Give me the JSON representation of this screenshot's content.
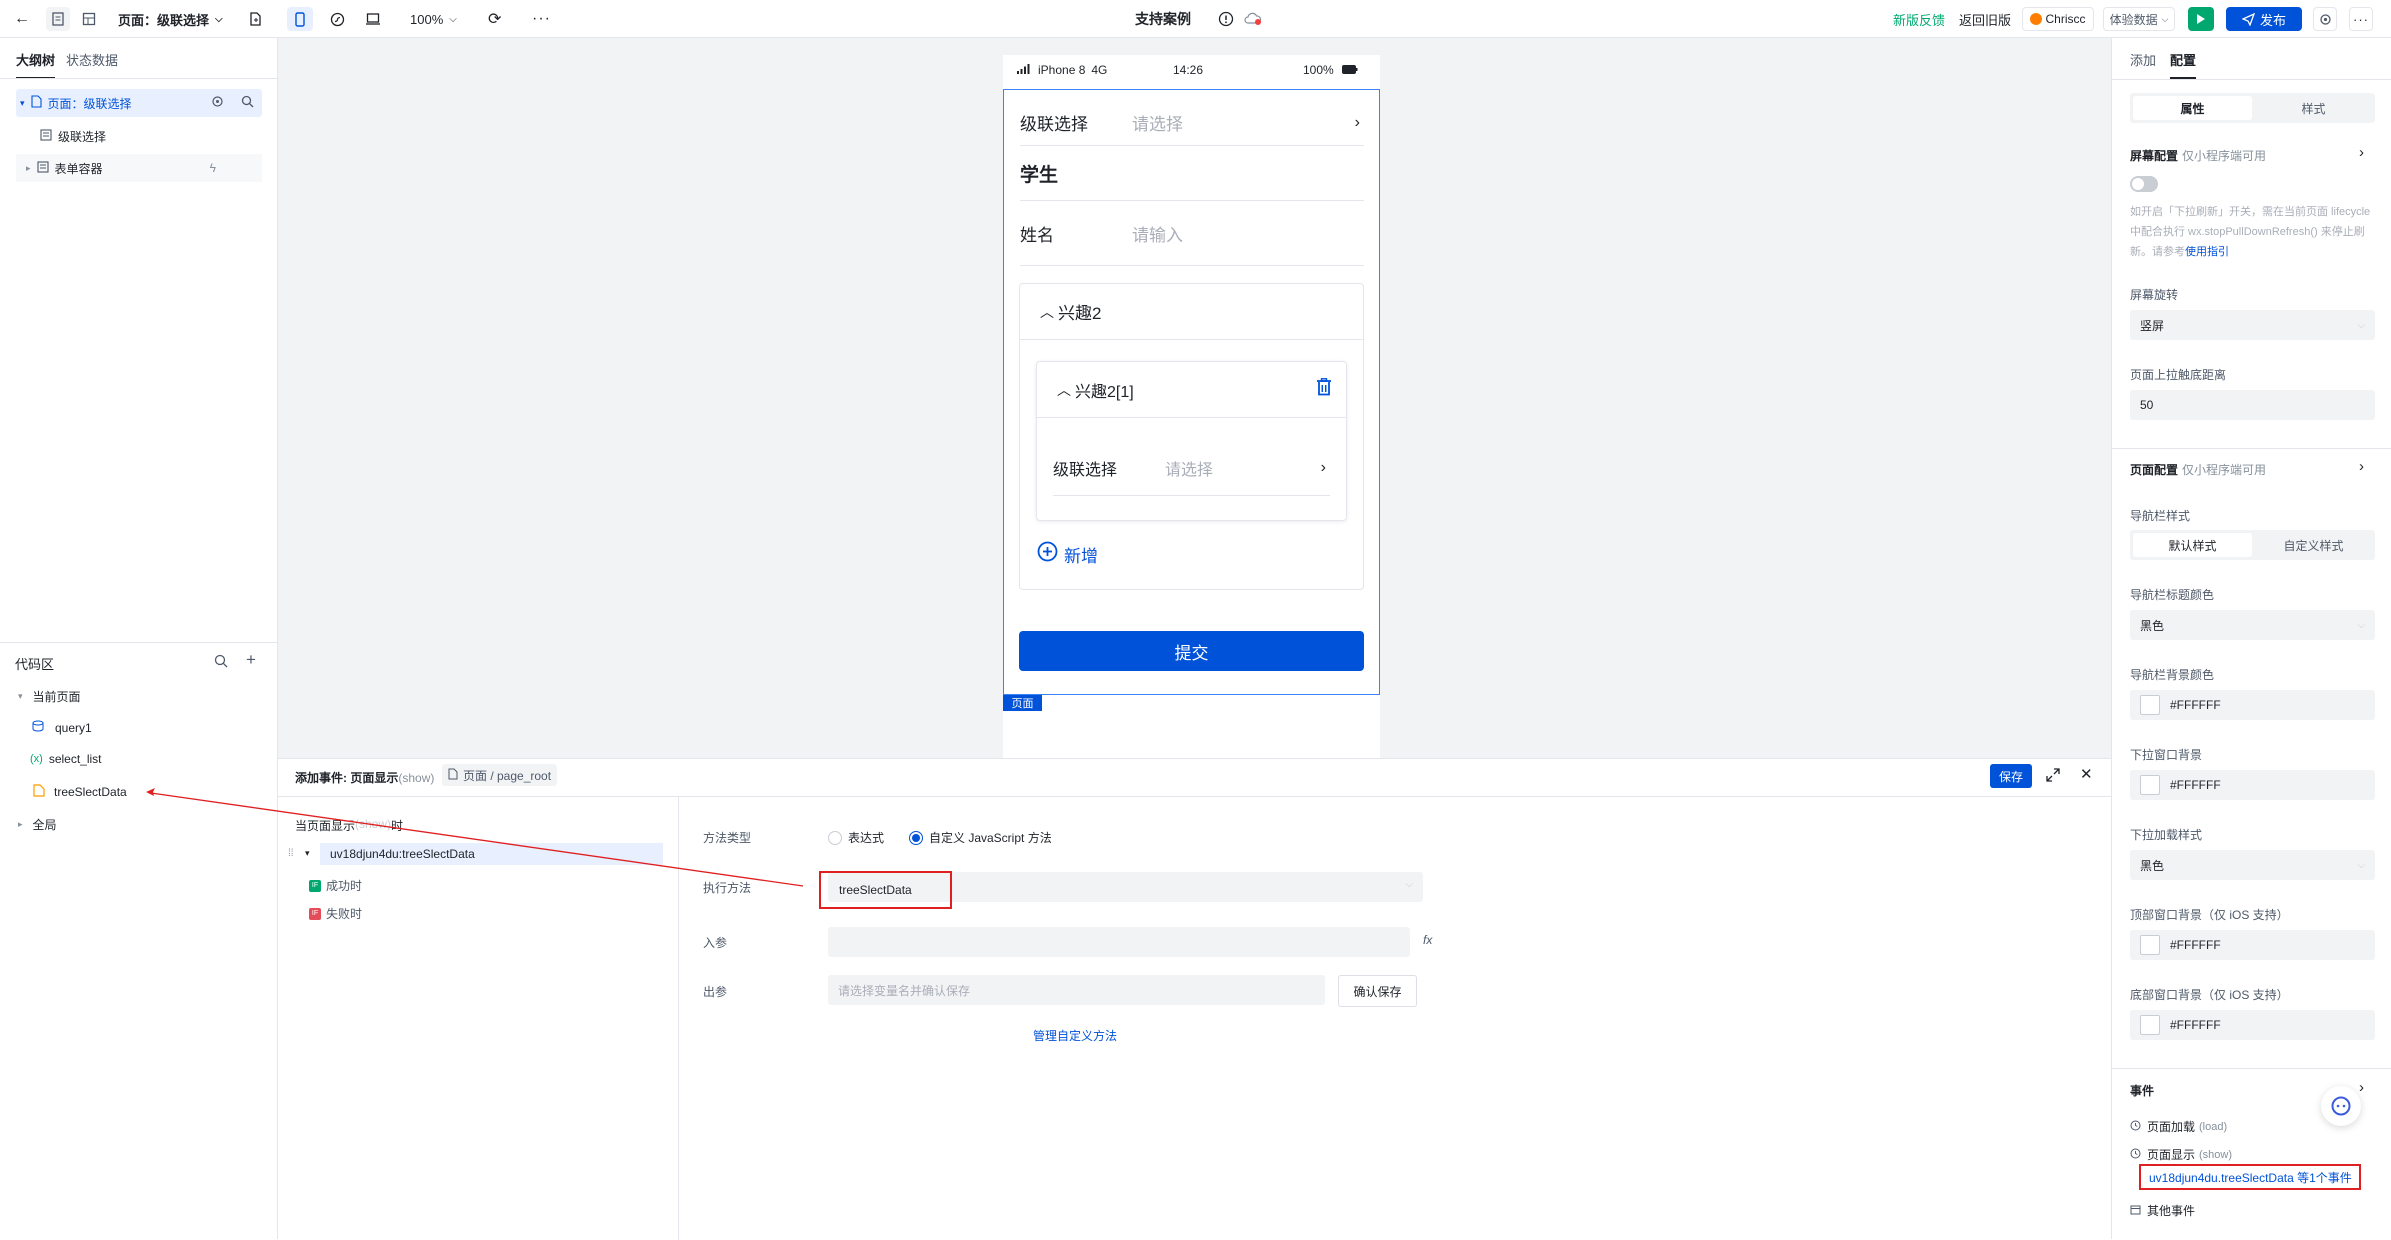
{
  "topbar": {
    "page_selector": "页面：级联选择",
    "zoom": "100%",
    "title": "支持案例",
    "feedback": "新版反馈",
    "back_old": "返回旧版",
    "user": "Chriscc",
    "experience_data": "体验数据",
    "publish": "发布"
  },
  "left": {
    "tabs": [
      "大纲树",
      "状态数据"
    ],
    "tree": {
      "root": "页面：级联选择",
      "child1": "级联选择",
      "child2": "表单容器"
    },
    "code_title": "代码区",
    "current_page": "当前页面",
    "items": [
      "query1",
      "select_list",
      "treeSlectData"
    ],
    "var_prefix": "(x)",
    "global": "全局"
  },
  "phone": {
    "carrier": "iPhone 8",
    "network": "4G",
    "time": "14:26",
    "battery": "100%",
    "row1_label": "级联选择",
    "row1_placeholder": "请选择",
    "section": "学生",
    "name_label": "姓名",
    "name_placeholder": "请输入",
    "group_title": "兴趣2",
    "item_title": "兴趣2[1]",
    "inner_label": "级联选择",
    "inner_placeholder": "请选择",
    "add": "新增",
    "submit": "提交",
    "page_badge": "页面"
  },
  "bottom": {
    "title": "添加事件: 页面显示",
    "title_hint": "(show)",
    "breadcrumb": "页面 / page_root",
    "save": "保存",
    "trigger_text": "当页面显示",
    "trigger_hint": "(show)",
    "trigger_suffix": "时",
    "action": "uv18djun4du:treeSlectData",
    "success": "成功时",
    "fail": "失败时",
    "method_type_label": "方法类型",
    "opt_expr": "表达式",
    "opt_js": "自定义 JavaScript 方法",
    "exec_label": "执行方法",
    "exec_value": "treeSlectData",
    "in_label": "入参",
    "out_label": "出参",
    "out_placeholder": "请选择变量名并确认保存",
    "confirm_save": "确认保存",
    "manage": "管理自定义方法"
  },
  "right": {
    "tabs": [
      "添加",
      "配置"
    ],
    "seg": [
      "属性",
      "样式"
    ],
    "screen_config": "屏幕配置",
    "mini_only": "仅小程序端可用",
    "pull_desc": "如开启「下拉刷新」开关，需在当前页面 lifecycle 中配合执行 wx.stopPullDownRefresh() 来停止刷新。请参考",
    "guide_link": "使用指引",
    "rotate_label": "屏幕旋转",
    "rotate_value": "竖屏",
    "reach_label": "页面上拉触底距离",
    "reach_value": "50",
    "page_config": "页面配置",
    "nav_style_label": "导航栏样式",
    "nav_style_opts": [
      "默认样式",
      "自定义样式"
    ],
    "nav_title_color_label": "导航栏标题颜色",
    "nav_title_color": "黑色",
    "nav_bg_label": "导航栏背景颜色",
    "nav_bg": "#FFFFFF",
    "pull_bg_label": "下拉窗口背景",
    "pull_bg": "#FFFFFF",
    "pull_style_label": "下拉加载样式",
    "pull_style": "黑色",
    "top_bg_label": "顶部窗口背景（仅 iOS 支持）",
    "top_bg": "#FFFFFF",
    "bottom_bg_label": "底部窗口背景（仅 iOS 支持）",
    "bottom_bg": "#FFFFFF",
    "events_title": "事件",
    "ev_load": "页面加载",
    "ev_load_hint": "(load)",
    "ev_show": "页面显示",
    "ev_show_hint": "(show)",
    "ev_show_detail": "uv18djun4du.treeSlectData 等1个事件",
    "ev_other": "其他事件"
  },
  "colors": {
    "accent": "#0052d9",
    "highlight": "#e02020",
    "green": "#00a870"
  }
}
